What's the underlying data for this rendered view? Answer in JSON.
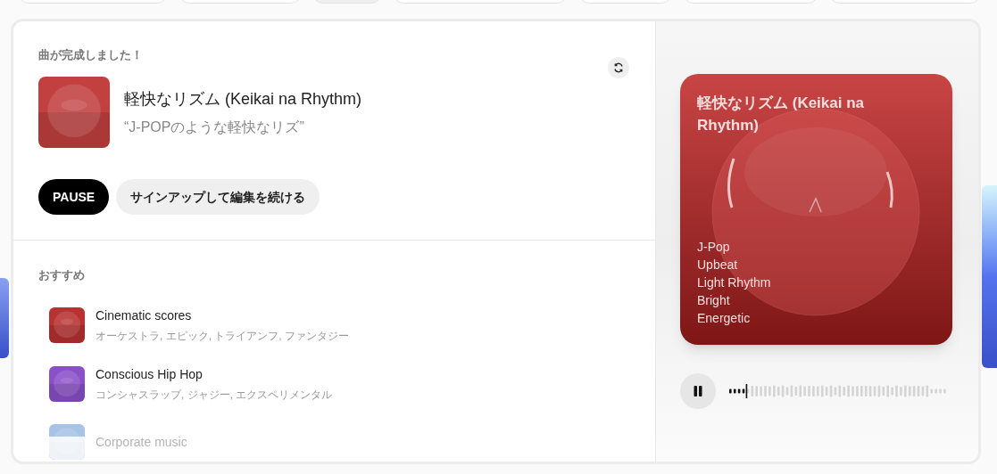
{
  "heading": "曲が完成しました！",
  "song": {
    "title": "軽快なリズム (Keikai na Rhythm)",
    "prompt": "“J-POPのような軽快なリズ”"
  },
  "buttons": [
    {
      "kind": "primary",
      "label": "PAUSE"
    },
    {
      "kind": "secondary",
      "label": "サインアップして編集を続ける"
    }
  ],
  "recommendations_heading": "おすすめ",
  "recommendations": [
    {
      "title": "Cinematic scores",
      "tags": "オーケストラ, エピック, トライアンフ, ファンタジー",
      "color": "#b83232"
    },
    {
      "title": "Conscious Hip Hop",
      "tags": "コンシャスラップ, ジャジー, エクスペリメンタル",
      "color": "#8a4fc9"
    },
    {
      "title": "Corporate music",
      "color": "#a9c3e6"
    }
  ],
  "cover": {
    "title": "軽快なリズム (Keikai na Rhythm)",
    "tags": [
      "J-Pop",
      "Upbeat",
      "Light Rhythm",
      "Bright",
      "Energetic"
    ]
  },
  "player": {
    "level": 0.07
  }
}
